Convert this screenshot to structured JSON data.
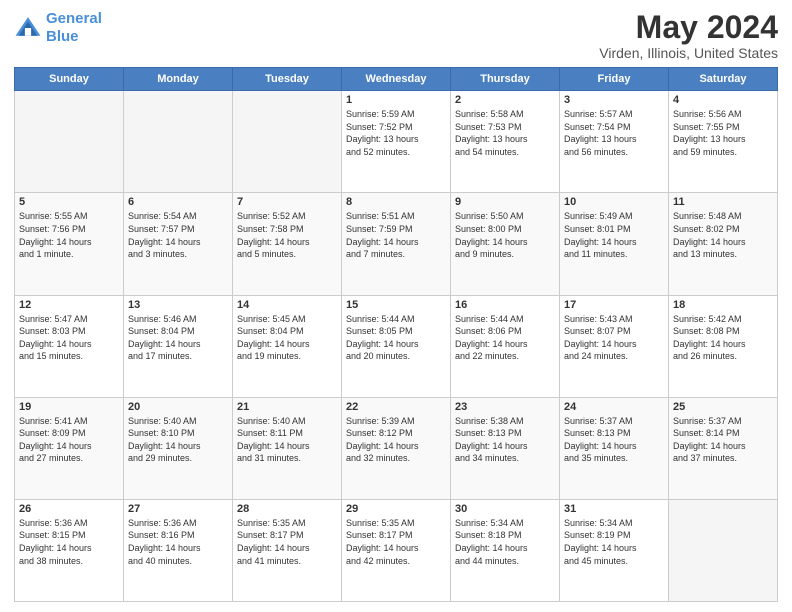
{
  "header": {
    "logo_line1": "General",
    "logo_line2": "Blue",
    "main_title": "May 2024",
    "subtitle": "Virden, Illinois, United States"
  },
  "calendar": {
    "days_of_week": [
      "Sunday",
      "Monday",
      "Tuesday",
      "Wednesday",
      "Thursday",
      "Friday",
      "Saturday"
    ],
    "weeks": [
      [
        {
          "day": "",
          "info": ""
        },
        {
          "day": "",
          "info": ""
        },
        {
          "day": "",
          "info": ""
        },
        {
          "day": "1",
          "info": "Sunrise: 5:59 AM\nSunset: 7:52 PM\nDaylight: 13 hours\nand 52 minutes."
        },
        {
          "day": "2",
          "info": "Sunrise: 5:58 AM\nSunset: 7:53 PM\nDaylight: 13 hours\nand 54 minutes."
        },
        {
          "day": "3",
          "info": "Sunrise: 5:57 AM\nSunset: 7:54 PM\nDaylight: 13 hours\nand 56 minutes."
        },
        {
          "day": "4",
          "info": "Sunrise: 5:56 AM\nSunset: 7:55 PM\nDaylight: 13 hours\nand 59 minutes."
        }
      ],
      [
        {
          "day": "5",
          "info": "Sunrise: 5:55 AM\nSunset: 7:56 PM\nDaylight: 14 hours\nand 1 minute."
        },
        {
          "day": "6",
          "info": "Sunrise: 5:54 AM\nSunset: 7:57 PM\nDaylight: 14 hours\nand 3 minutes."
        },
        {
          "day": "7",
          "info": "Sunrise: 5:52 AM\nSunset: 7:58 PM\nDaylight: 14 hours\nand 5 minutes."
        },
        {
          "day": "8",
          "info": "Sunrise: 5:51 AM\nSunset: 7:59 PM\nDaylight: 14 hours\nand 7 minutes."
        },
        {
          "day": "9",
          "info": "Sunrise: 5:50 AM\nSunset: 8:00 PM\nDaylight: 14 hours\nand 9 minutes."
        },
        {
          "day": "10",
          "info": "Sunrise: 5:49 AM\nSunset: 8:01 PM\nDaylight: 14 hours\nand 11 minutes."
        },
        {
          "day": "11",
          "info": "Sunrise: 5:48 AM\nSunset: 8:02 PM\nDaylight: 14 hours\nand 13 minutes."
        }
      ],
      [
        {
          "day": "12",
          "info": "Sunrise: 5:47 AM\nSunset: 8:03 PM\nDaylight: 14 hours\nand 15 minutes."
        },
        {
          "day": "13",
          "info": "Sunrise: 5:46 AM\nSunset: 8:04 PM\nDaylight: 14 hours\nand 17 minutes."
        },
        {
          "day": "14",
          "info": "Sunrise: 5:45 AM\nSunset: 8:04 PM\nDaylight: 14 hours\nand 19 minutes."
        },
        {
          "day": "15",
          "info": "Sunrise: 5:44 AM\nSunset: 8:05 PM\nDaylight: 14 hours\nand 20 minutes."
        },
        {
          "day": "16",
          "info": "Sunrise: 5:44 AM\nSunset: 8:06 PM\nDaylight: 14 hours\nand 22 minutes."
        },
        {
          "day": "17",
          "info": "Sunrise: 5:43 AM\nSunset: 8:07 PM\nDaylight: 14 hours\nand 24 minutes."
        },
        {
          "day": "18",
          "info": "Sunrise: 5:42 AM\nSunset: 8:08 PM\nDaylight: 14 hours\nand 26 minutes."
        }
      ],
      [
        {
          "day": "19",
          "info": "Sunrise: 5:41 AM\nSunset: 8:09 PM\nDaylight: 14 hours\nand 27 minutes."
        },
        {
          "day": "20",
          "info": "Sunrise: 5:40 AM\nSunset: 8:10 PM\nDaylight: 14 hours\nand 29 minutes."
        },
        {
          "day": "21",
          "info": "Sunrise: 5:40 AM\nSunset: 8:11 PM\nDaylight: 14 hours\nand 31 minutes."
        },
        {
          "day": "22",
          "info": "Sunrise: 5:39 AM\nSunset: 8:12 PM\nDaylight: 14 hours\nand 32 minutes."
        },
        {
          "day": "23",
          "info": "Sunrise: 5:38 AM\nSunset: 8:13 PM\nDaylight: 14 hours\nand 34 minutes."
        },
        {
          "day": "24",
          "info": "Sunrise: 5:37 AM\nSunset: 8:13 PM\nDaylight: 14 hours\nand 35 minutes."
        },
        {
          "day": "25",
          "info": "Sunrise: 5:37 AM\nSunset: 8:14 PM\nDaylight: 14 hours\nand 37 minutes."
        }
      ],
      [
        {
          "day": "26",
          "info": "Sunrise: 5:36 AM\nSunset: 8:15 PM\nDaylight: 14 hours\nand 38 minutes."
        },
        {
          "day": "27",
          "info": "Sunrise: 5:36 AM\nSunset: 8:16 PM\nDaylight: 14 hours\nand 40 minutes."
        },
        {
          "day": "28",
          "info": "Sunrise: 5:35 AM\nSunset: 8:17 PM\nDaylight: 14 hours\nand 41 minutes."
        },
        {
          "day": "29",
          "info": "Sunrise: 5:35 AM\nSunset: 8:17 PM\nDaylight: 14 hours\nand 42 minutes."
        },
        {
          "day": "30",
          "info": "Sunrise: 5:34 AM\nSunset: 8:18 PM\nDaylight: 14 hours\nand 44 minutes."
        },
        {
          "day": "31",
          "info": "Sunrise: 5:34 AM\nSunset: 8:19 PM\nDaylight: 14 hours\nand 45 minutes."
        },
        {
          "day": "",
          "info": ""
        }
      ]
    ]
  },
  "colors": {
    "header_bg": "#4a7fc1",
    "accent": "#4a90d9"
  }
}
